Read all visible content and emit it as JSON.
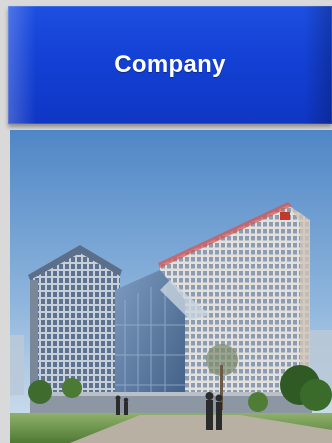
{
  "banner": {
    "title": "Company"
  },
  "photo": {
    "subject": "building-illustration"
  },
  "colors": {
    "banner_blue": "#1442d6",
    "sky": "#6f9fd0",
    "glass": "#5e7ea6",
    "grass": "#6e9c4a"
  }
}
